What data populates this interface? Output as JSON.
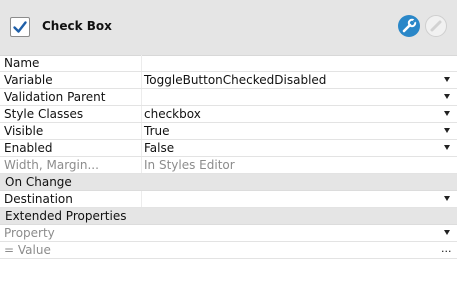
{
  "header": {
    "title": "Check Box",
    "checked": true,
    "active_tool_color": "#2a87c8"
  },
  "properties": {
    "name": {
      "label": "Name",
      "value": ""
    },
    "variable": {
      "label": "Variable",
      "value": "ToggleButtonCheckedDisabled"
    },
    "validation_parent": {
      "label": "Validation Parent",
      "value": ""
    },
    "style_classes": {
      "label": "Style Classes",
      "value": "checkbox"
    },
    "visible": {
      "label": "Visible",
      "value": "True"
    },
    "enabled": {
      "label": "Enabled",
      "value": "False"
    },
    "width_margin": {
      "label": "Width, Margin...",
      "value": "In Styles Editor"
    }
  },
  "on_change": {
    "title": "On Change",
    "destination": {
      "label": "Destination",
      "value": ""
    }
  },
  "extended": {
    "title": "Extended Properties",
    "property_placeholder": "Property",
    "value_placeholder": "=  Value",
    "more_label": "..."
  },
  "icons": {
    "wrench": "wrench-icon",
    "disabled_tool": "slash-icon",
    "dropdown": "chevron-down-icon"
  }
}
